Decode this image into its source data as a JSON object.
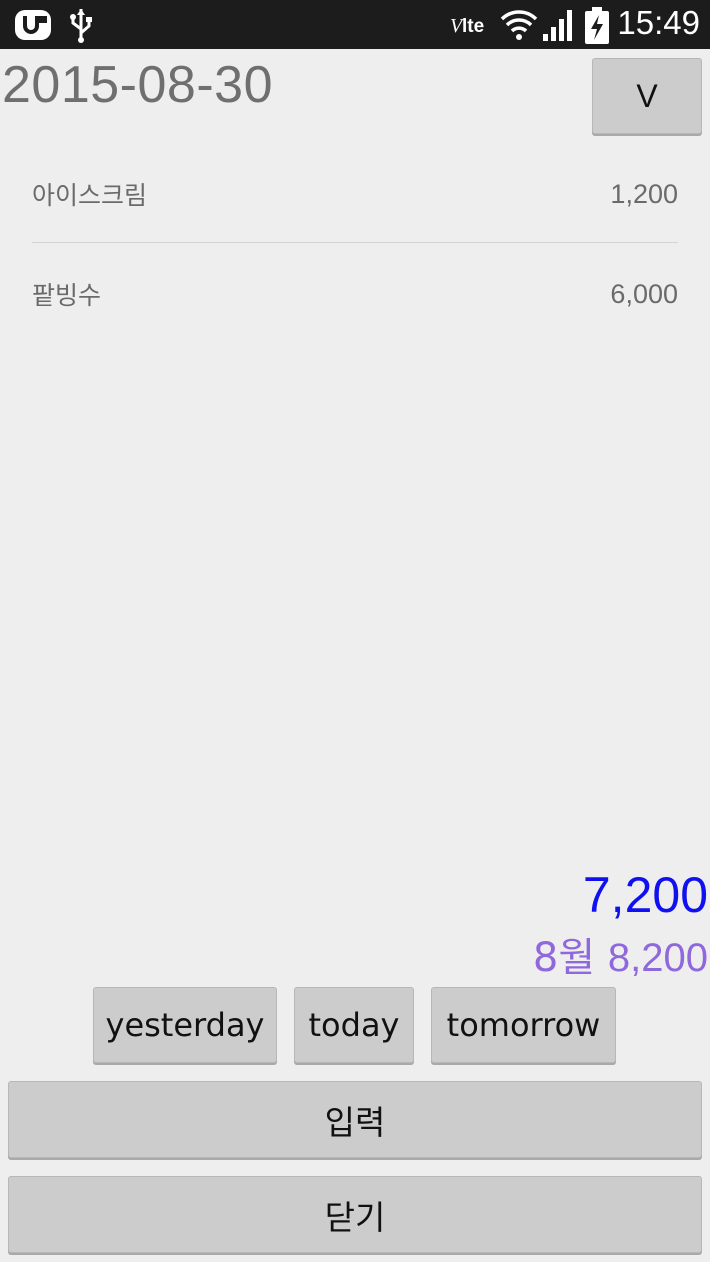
{
  "status_bar": {
    "time": "15:49",
    "network_label": "lte",
    "icons": [
      "u-plus-icon",
      "usb-icon",
      "volte-icon",
      "wifi-icon",
      "signal-icon",
      "battery-charging-icon"
    ]
  },
  "header": {
    "date": "2015-08-30",
    "v_button_label": "V"
  },
  "entries": [
    {
      "name": "아이스크림",
      "amount": "1,200"
    },
    {
      "name": "팥빙수",
      "amount": "6,000"
    }
  ],
  "totals": {
    "day_total": "7,200",
    "month_label": "8월",
    "month_total": "8,200",
    "day_total_color": "#1010f0",
    "month_total_color": "#9068dd"
  },
  "nav": {
    "yesterday": "yesterday",
    "today": "today",
    "tomorrow": "tomorrow"
  },
  "actions": {
    "input": "입력",
    "close": "닫기"
  }
}
